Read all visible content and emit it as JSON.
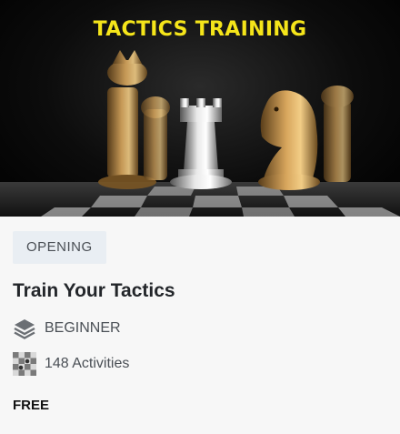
{
  "banner": {
    "title": "TACTICS TRAINING",
    "title_color": "#f5e51a"
  },
  "course": {
    "tag": "OPENING",
    "title": "Train Your Tactics",
    "level": {
      "icon": "layers-icon",
      "label": "BEGINNER"
    },
    "activities": {
      "icon": "chessboard-icon",
      "label": "148 Activities"
    },
    "price": "FREE"
  },
  "colors": {
    "tag_bg": "#e9eef3",
    "card_bg": "#f7f7f7",
    "text_dark": "#23262a",
    "text_muted": "#4a4f55"
  }
}
